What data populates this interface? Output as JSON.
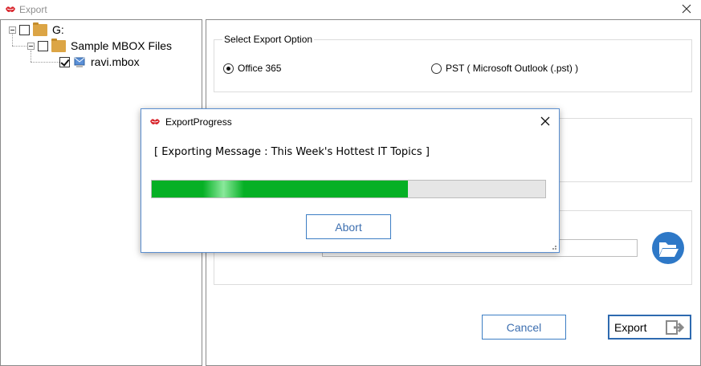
{
  "window": {
    "title": "Export"
  },
  "tree": {
    "root": {
      "label": "G:",
      "checked": false
    },
    "folder": {
      "label": "Sample MBOX Files",
      "checked": false
    },
    "file": {
      "label": "ravi.mbox",
      "checked": true
    }
  },
  "export_option": {
    "group_title": "Select Export Option",
    "options": [
      {
        "label": "Office 365",
        "selected": true
      },
      {
        "label": "PST ( Microsoft Outlook (.pst) )",
        "selected": false
      }
    ]
  },
  "destination": {
    "path_value": ""
  },
  "buttons": {
    "cancel_label": "Cancel",
    "export_label": "Export"
  },
  "progress_dialog": {
    "title": "ExportProgress",
    "message": "[ Exporting Message : This Week's Hottest IT Topics ]",
    "progress_percent": 65,
    "abort_label": "Abort"
  },
  "colors": {
    "progress_green": "#06b025",
    "accent_blue": "#3d7ec4",
    "folder_gold": "#dca545",
    "brand_red": "#d8232a"
  },
  "icons": {
    "app": "lips-logo-icon",
    "close": "close-icon",
    "browse": "folder-open-icon",
    "export": "export-arrow-icon",
    "file": "mbox-file-icon"
  }
}
